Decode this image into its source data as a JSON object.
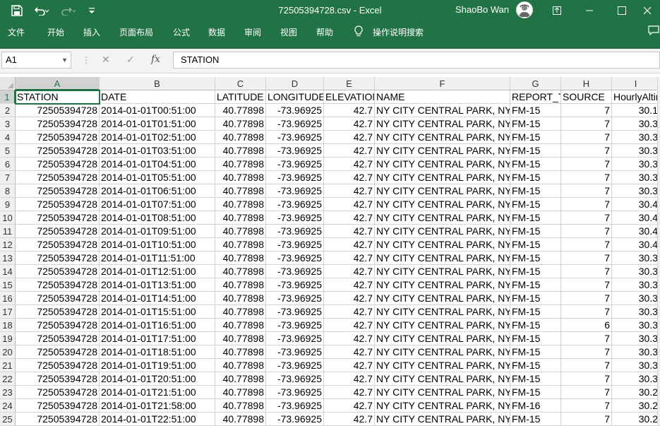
{
  "window": {
    "title": "72505394728.csv  -  Excel",
    "user": "ShaoBo Wan",
    "qat": [
      "save-icon",
      "undo-icon",
      "redo-icon",
      "customize-qat-icon"
    ],
    "controls": [
      "ribbon-display-icon",
      "minimize-icon",
      "maximize-icon",
      "close-icon"
    ]
  },
  "ribbon": {
    "tabs": [
      "文件",
      "开始",
      "插入",
      "页面布局",
      "公式",
      "数据",
      "审阅",
      "视图",
      "帮助"
    ],
    "tell_me": "操作说明搜索"
  },
  "formula_bar": {
    "name_box": "A1",
    "formula": "STATION"
  },
  "sheet": {
    "columns": [
      "A",
      "B",
      "C",
      "D",
      "E",
      "F",
      "G",
      "H",
      "I"
    ],
    "selected_column": "A",
    "selected_row": "1",
    "active_cell": "A1",
    "header_row": [
      "STATION",
      "DATE",
      "LATITUDE",
      "LONGITUDE",
      "ELEVATION",
      "NAME",
      "REPORT_TYPE",
      "SOURCE",
      "HourlyAltimeterSetting"
    ],
    "rows": [
      {
        "n": "2",
        "station": "72505394728",
        "date": "2014-01-01T00:51:00",
        "lat": "40.77898",
        "lon": "-73.96925",
        "elev": "42.7",
        "name": "NY CITY CENTRAL PARK, NY US",
        "report": "FM-15",
        "source": "7",
        "alt": "30.1"
      },
      {
        "n": "3",
        "station": "72505394728",
        "date": "2014-01-01T01:51:00",
        "lat": "40.77898",
        "lon": "-73.96925",
        "elev": "42.7",
        "name": "NY CITY CENTRAL PARK, NY US",
        "report": "FM-15",
        "source": "7",
        "alt": "30.3"
      },
      {
        "n": "4",
        "station": "72505394728",
        "date": "2014-01-01T02:51:00",
        "lat": "40.77898",
        "lon": "-73.96925",
        "elev": "42.7",
        "name": "NY CITY CENTRAL PARK, NY US",
        "report": "FM-15",
        "source": "7",
        "alt": "30.3"
      },
      {
        "n": "5",
        "station": "72505394728",
        "date": "2014-01-01T03:51:00",
        "lat": "40.77898",
        "lon": "-73.96925",
        "elev": "42.7",
        "name": "NY CITY CENTRAL PARK, NY US",
        "report": "FM-15",
        "source": "7",
        "alt": "30.3"
      },
      {
        "n": "6",
        "station": "72505394728",
        "date": "2014-01-01T04:51:00",
        "lat": "40.77898",
        "lon": "-73.96925",
        "elev": "42.7",
        "name": "NY CITY CENTRAL PARK, NY US",
        "report": "FM-15",
        "source": "7",
        "alt": "30.3"
      },
      {
        "n": "7",
        "station": "72505394728",
        "date": "2014-01-01T05:51:00",
        "lat": "40.77898",
        "lon": "-73.96925",
        "elev": "42.7",
        "name": "NY CITY CENTRAL PARK, NY US",
        "report": "FM-15",
        "source": "7",
        "alt": "30.3"
      },
      {
        "n": "8",
        "station": "72505394728",
        "date": "2014-01-01T06:51:00",
        "lat": "40.77898",
        "lon": "-73.96925",
        "elev": "42.7",
        "name": "NY CITY CENTRAL PARK, NY US",
        "report": "FM-15",
        "source": "7",
        "alt": "30.3"
      },
      {
        "n": "9",
        "station": "72505394728",
        "date": "2014-01-01T07:51:00",
        "lat": "40.77898",
        "lon": "-73.96925",
        "elev": "42.7",
        "name": "NY CITY CENTRAL PARK, NY US",
        "report": "FM-15",
        "source": "7",
        "alt": "30.4"
      },
      {
        "n": "10",
        "station": "72505394728",
        "date": "2014-01-01T08:51:00",
        "lat": "40.77898",
        "lon": "-73.96925",
        "elev": "42.7",
        "name": "NY CITY CENTRAL PARK, NY US",
        "report": "FM-15",
        "source": "7",
        "alt": "30.4"
      },
      {
        "n": "11",
        "station": "72505394728",
        "date": "2014-01-01T09:51:00",
        "lat": "40.77898",
        "lon": "-73.96925",
        "elev": "42.7",
        "name": "NY CITY CENTRAL PARK, NY US",
        "report": "FM-15",
        "source": "7",
        "alt": "30.4"
      },
      {
        "n": "12",
        "station": "72505394728",
        "date": "2014-01-01T10:51:00",
        "lat": "40.77898",
        "lon": "-73.96925",
        "elev": "42.7",
        "name": "NY CITY CENTRAL PARK, NY US",
        "report": "FM-15",
        "source": "7",
        "alt": "30.4"
      },
      {
        "n": "13",
        "station": "72505394728",
        "date": "2014-01-01T11:51:00",
        "lat": "40.77898",
        "lon": "-73.96925",
        "elev": "42.7",
        "name": "NY CITY CENTRAL PARK, NY US",
        "report": "FM-15",
        "source": "7",
        "alt": "30.3"
      },
      {
        "n": "14",
        "station": "72505394728",
        "date": "2014-01-01T12:51:00",
        "lat": "40.77898",
        "lon": "-73.96925",
        "elev": "42.7",
        "name": "NY CITY CENTRAL PARK, NY US",
        "report": "FM-15",
        "source": "7",
        "alt": "30.3"
      },
      {
        "n": "15",
        "station": "72505394728",
        "date": "2014-01-01T13:51:00",
        "lat": "40.77898",
        "lon": "-73.96925",
        "elev": "42.7",
        "name": "NY CITY CENTRAL PARK, NY US",
        "report": "FM-15",
        "source": "7",
        "alt": "30.3"
      },
      {
        "n": "16",
        "station": "72505394728",
        "date": "2014-01-01T14:51:00",
        "lat": "40.77898",
        "lon": "-73.96925",
        "elev": "42.7",
        "name": "NY CITY CENTRAL PARK, NY US",
        "report": "FM-15",
        "source": "7",
        "alt": "30.3"
      },
      {
        "n": "17",
        "station": "72505394728",
        "date": "2014-01-01T15:51:00",
        "lat": "40.77898",
        "lon": "-73.96925",
        "elev": "42.7",
        "name": "NY CITY CENTRAL PARK, NY US",
        "report": "FM-15",
        "source": "7",
        "alt": "30.3"
      },
      {
        "n": "18",
        "station": "72505394728",
        "date": "2014-01-01T16:51:00",
        "lat": "40.77898",
        "lon": "-73.96925",
        "elev": "42.7",
        "name": "NY CITY CENTRAL PARK, NY US",
        "report": "FM-15",
        "source": "6",
        "alt": "30.3"
      },
      {
        "n": "19",
        "station": "72505394728",
        "date": "2014-01-01T17:51:00",
        "lat": "40.77898",
        "lon": "-73.96925",
        "elev": "42.7",
        "name": "NY CITY CENTRAL PARK, NY US",
        "report": "FM-15",
        "source": "7",
        "alt": "30.3"
      },
      {
        "n": "20",
        "station": "72505394728",
        "date": "2014-01-01T18:51:00",
        "lat": "40.77898",
        "lon": "-73.96925",
        "elev": "42.7",
        "name": "NY CITY CENTRAL PARK, NY US",
        "report": "FM-15",
        "source": "7",
        "alt": "30.3"
      },
      {
        "n": "21",
        "station": "72505394728",
        "date": "2014-01-01T19:51:00",
        "lat": "40.77898",
        "lon": "-73.96925",
        "elev": "42.7",
        "name": "NY CITY CENTRAL PARK, NY US",
        "report": "FM-15",
        "source": "7",
        "alt": "30.3"
      },
      {
        "n": "22",
        "station": "72505394728",
        "date": "2014-01-01T20:51:00",
        "lat": "40.77898",
        "lon": "-73.96925",
        "elev": "42.7",
        "name": "NY CITY CENTRAL PARK, NY US",
        "report": "FM-15",
        "source": "7",
        "alt": "30.3"
      },
      {
        "n": "23",
        "station": "72505394728",
        "date": "2014-01-01T21:51:00",
        "lat": "40.77898",
        "lon": "-73.96925",
        "elev": "42.7",
        "name": "NY CITY CENTRAL PARK, NY US",
        "report": "FM-15",
        "source": "7",
        "alt": "30.2"
      },
      {
        "n": "24",
        "station": "72505394728",
        "date": "2014-01-01T21:58:00",
        "lat": "40.77898",
        "lon": "-73.96925",
        "elev": "42.7",
        "name": "NY CITY CENTRAL PARK, NY US",
        "report": "FM-16",
        "source": "7",
        "alt": "30.2"
      },
      {
        "n": "25",
        "station": "72505394728",
        "date": "2014-01-01T22:51:00",
        "lat": "40.77898",
        "lon": "-73.96925",
        "elev": "42.7",
        "name": "NY CITY CENTRAL PARK, NY US",
        "report": "FM-15",
        "source": "7",
        "alt": "30.2"
      }
    ]
  }
}
